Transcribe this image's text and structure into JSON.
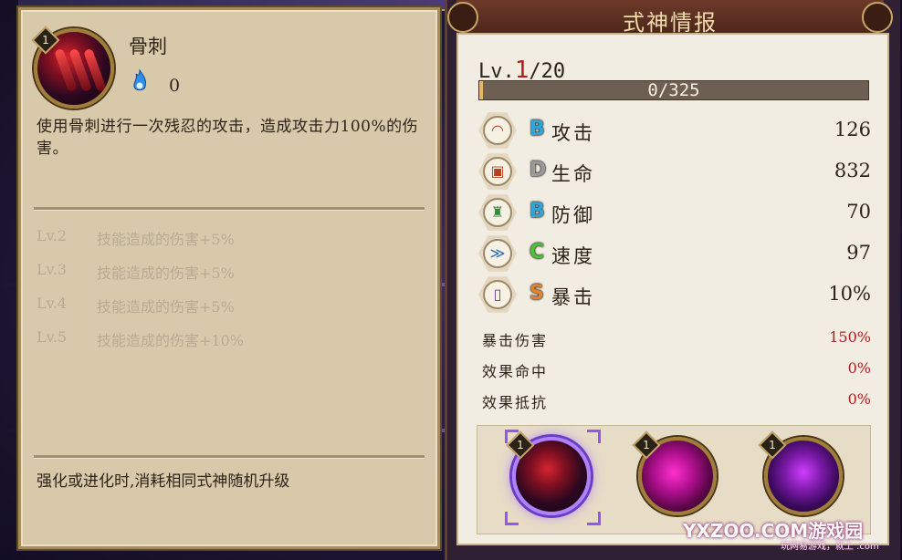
{
  "skill": {
    "level_badge": "1",
    "name": "骨刺",
    "cost_value": "0",
    "description": "使用骨刺进行一次残忍的攻击，造成攻击力100%的伤害。",
    "upgrades": [
      {
        "level": "Lv.2",
        "effect": "技能造成的伤害+5%"
      },
      {
        "level": "Lv.3",
        "effect": "技能造成的伤害+5%"
      },
      {
        "level": "Lv.4",
        "effect": "技能造成的伤害+5%"
      },
      {
        "level": "Lv.5",
        "effect": "技能造成的伤害+10%"
      }
    ],
    "note": "强化或进化时,消耗相同式神随机升级"
  },
  "info_panel": {
    "title": "式神情报",
    "level_prefix": "Lv.",
    "level_current": "1",
    "level_max": "/20",
    "exp_text": "0/325",
    "exp_fraction": 0.01,
    "stats": [
      {
        "grade": "B",
        "grade_color": "#2fa6d8",
        "name": "攻击",
        "value": "126",
        "icon": "fan-icon",
        "icon_glyph": "◠",
        "icon_color": "#b33a2a"
      },
      {
        "grade": "D",
        "grade_color": "#9a9a9a",
        "name": "生命",
        "value": "832",
        "icon": "scroll-icon",
        "icon_glyph": "▣",
        "icon_color": "#b5421f"
      },
      {
        "grade": "B",
        "grade_color": "#2fa6d8",
        "name": "防御",
        "value": "70",
        "icon": "armor-icon",
        "icon_glyph": "♜",
        "icon_color": "#2f8a3a"
      },
      {
        "grade": "C",
        "grade_color": "#4ebf3a",
        "name": "速度",
        "value": "97",
        "icon": "speed-icon",
        "icon_glyph": "≫",
        "icon_color": "#2c6fb8"
      },
      {
        "grade": "S",
        "grade_color": "#e0852a",
        "name": "暴击",
        "value": "10%",
        "icon": "talisman-icon",
        "icon_glyph": "▯",
        "icon_color": "#6a3a9c"
      }
    ],
    "sub_stats": [
      {
        "name": "暴击伤害",
        "value": "150%"
      },
      {
        "name": "效果命中",
        "value": "0%"
      },
      {
        "name": "效果抵抗",
        "value": "0%"
      }
    ],
    "skill_slots": [
      {
        "badge": "1",
        "selected": true
      },
      {
        "badge": "1",
        "selected": false
      },
      {
        "badge": "1",
        "selected": false
      }
    ]
  },
  "watermark": {
    "main": "YXZOO.COM游戏园",
    "sub": "玩网易游戏，就上 .com"
  }
}
